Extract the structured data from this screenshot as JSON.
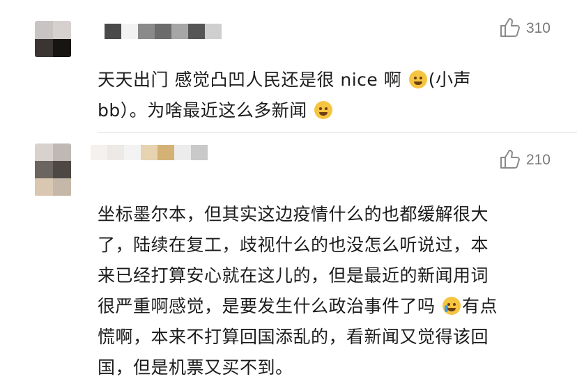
{
  "comments": [
    {
      "likes": "310",
      "text_parts": [
        "天天出门 感觉凸凹人民还是很 nice 啊 ",
        "(小声\nbb）。为啥最近这么多新闻 "
      ],
      "emojis": [
        "laugh-cry-icon",
        "shrug-icon"
      ],
      "avatar_colors": [
        "#c8c4c4",
        "#d6d0cf",
        "#3a3533",
        "#171514"
      ],
      "name_colors": [
        "#4a4a4a",
        "#f2f2f2",
        "#8a8a8a",
        "#6c6c6c",
        "#a6a6a6",
        "#555555",
        "#cfcfcf"
      ]
    },
    {
      "likes": "210",
      "text_parts": [
        "坐标墨尔本，但其实这边疫情什么的也都缓解很大\n了，陆续在复工，歧视什么的也没怎么听说过，本\n来已经打算安心就在这儿的，但是最近的新闻用词\n很严重啊感觉，是要发生什么政治事件了吗 ",
        "有点\n慌啊，本来不打算回国添乱的，看新闻又觉得该回\n国，但是机票又买不到。"
      ],
      "emojis": [
        "crying-icon"
      ],
      "avatar_colors": [
        "#d8d2cf",
        "#bfb8b4",
        "#6b6560",
        "#4e4845",
        "#d9c7b2",
        "#c6b8a8"
      ],
      "name_colors": [
        "#f4f1ee",
        "#ece9e6",
        "#f3f3f3",
        "#e7d3b0",
        "#d4b276",
        "#ececec",
        "#c9c9c9"
      ]
    }
  ],
  "colors": {
    "text": "#1c1c1c",
    "muted": "#7a7a7a",
    "divider": "#e6e6e6"
  }
}
